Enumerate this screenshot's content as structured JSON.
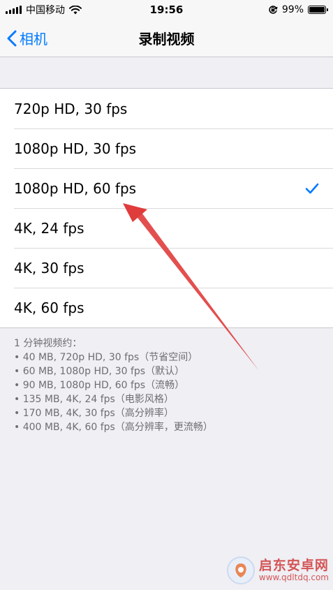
{
  "status_bar": {
    "carrier": "中国移动",
    "time": "19:56",
    "battery_percent": "99%",
    "battery_level": 0.99,
    "icons": [
      "signal-icon",
      "wifi-icon",
      "orientation-lock-icon",
      "battery-icon"
    ]
  },
  "nav": {
    "back_label": "相机",
    "title": "录制视频"
  },
  "options": [
    {
      "label": "720p HD, 30 fps",
      "selected": false
    },
    {
      "label": "1080p HD, 30 fps",
      "selected": false
    },
    {
      "label": "1080p HD, 60 fps",
      "selected": true
    },
    {
      "label": "4K, 24 fps",
      "selected": false
    },
    {
      "label": "4K, 30 fps",
      "selected": false
    },
    {
      "label": "4K, 60 fps",
      "selected": false
    }
  ],
  "footer": {
    "heading": "1 分钟视频约：",
    "lines": [
      "• 40 MB, 720p HD, 30 fps（节省空间）",
      "• 60 MB, 1080p HD, 30 fps（默认）",
      "• 90 MB, 1080p HD, 60 fps（流畅）",
      "• 135 MB, 4K, 24 fps（电影风格）",
      "• 170 MB, 4K, 30 fps（高分辨率）",
      "• 400 MB, 4K, 60 fps（高分辨率，更流畅）"
    ]
  },
  "colors": {
    "accent": "#007aff",
    "annotation": "#e03c3c",
    "background": "#efeff4"
  },
  "watermark": {
    "name": "启东安卓网",
    "url": "www.qdltdq.com"
  }
}
